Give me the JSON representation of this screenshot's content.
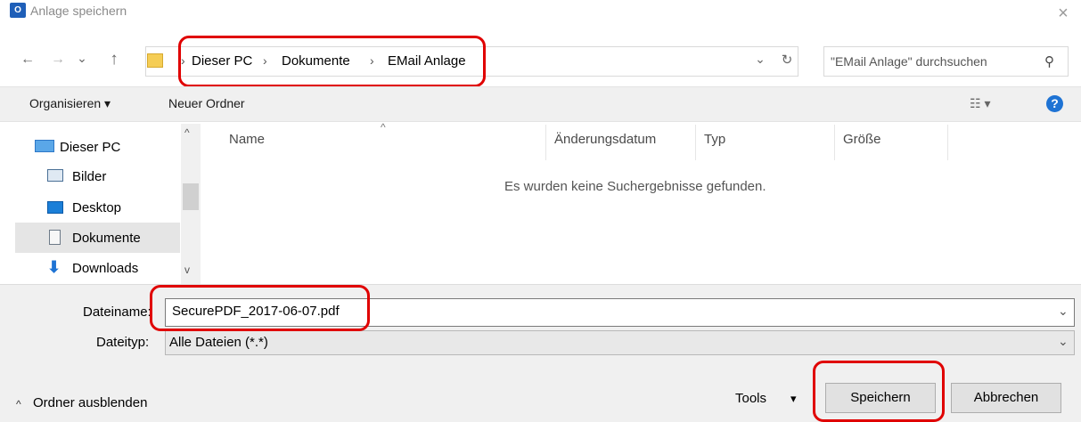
{
  "window": {
    "app_icon_text": "O",
    "title": "Anlage speichern",
    "close_label": "×"
  },
  "nav": {
    "back_icon": "←",
    "forward_icon": "→",
    "recent_icon": "⌄",
    "up_icon": "↑",
    "breadcrumb": [
      "Dieser PC",
      "Dokumente",
      "EMail Anlage"
    ],
    "breadcrumb_sep": "›",
    "dropdown_icon": "⌄",
    "refresh_icon": "↻",
    "search_placeholder": "\"EMail Anlage\" durchsuchen",
    "search_icon": "⚲"
  },
  "toolbar": {
    "organize_label": "Organisieren ▾",
    "new_folder_label": "Neuer Ordner",
    "view_icon": "☷ ▾",
    "help_icon": "?"
  },
  "sidebar": {
    "items": [
      {
        "label": "Dieser PC",
        "icon": "computer-icon"
      },
      {
        "label": "Bilder",
        "icon": "pictures-icon"
      },
      {
        "label": "Desktop",
        "icon": "desktop-icon"
      },
      {
        "label": "Dokumente",
        "icon": "documents-icon"
      },
      {
        "label": "Downloads",
        "icon": "downloads-icon"
      }
    ],
    "selected": "Dokumente",
    "scroll_up": "^",
    "scroll_down": "v"
  },
  "content": {
    "columns": [
      "Name",
      "Änderungsdatum",
      "Typ",
      "Größe"
    ],
    "sort_indicator": "^",
    "empty_message": "Es wurden keine Suchergebnisse gefunden."
  },
  "form": {
    "filename_label": "Dateiname:",
    "filename_value": "SecurePDF_2017-06-07.pdf",
    "filetype_label": "Dateityp:",
    "filetype_value": "Alle Dateien (*.*)",
    "dropdown_icon": "⌄"
  },
  "footer": {
    "hide_folders_icon": "^",
    "hide_folders_label": "Ordner ausblenden",
    "tools_label": "Tools",
    "tools_icon": "▾",
    "save_label": "Speichern",
    "cancel_label": "Abbrechen"
  },
  "colors": {
    "highlight": "#e00000",
    "accent": "#1e73d4"
  }
}
